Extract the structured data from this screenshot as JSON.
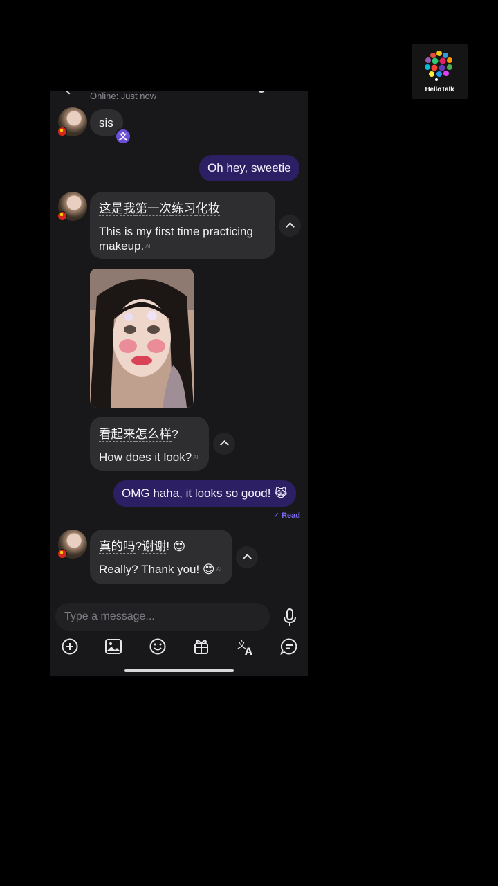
{
  "brand": {
    "name": "HelloTalk"
  },
  "chat": {
    "status": "Online: Just now",
    "input_placeholder": "Type a message...",
    "messages": [
      {
        "text": "sis"
      },
      {
        "text": "Oh hey, sweetie"
      },
      {
        "original": [
          "这是我",
          "第一次",
          "练习",
          "化妆"
        ],
        "translation": "This is my first time practicing makeup.",
        "ai": "AI"
      },
      {
        "original": [
          "看起来",
          "怎么样",
          "?"
        ],
        "translation": "How does it look?",
        "ai": "AI"
      },
      {
        "text": "OMG haha, it looks so good! 😹",
        "receipt": "Read"
      },
      {
        "original": [
          "真的吗",
          "?",
          "谢谢",
          "! 😍"
        ],
        "translation": "Really? Thank you! 😍",
        "ai": "AI"
      }
    ]
  },
  "icons": {
    "toolbar": [
      "plus-circle-icon",
      "image-icon",
      "smiley-icon",
      "gift-icon",
      "translate-icon",
      "chat-bubble-icon"
    ],
    "other": [
      "back-icon",
      "translate-badge-icon",
      "microphone-icon",
      "collapse-icon"
    ]
  },
  "colors": {
    "outgoing_bubble": "#2d1f63",
    "incoming_bubble": "#2e2e31",
    "read_receipt": "#7c6cf0",
    "background": "#18181a"
  }
}
